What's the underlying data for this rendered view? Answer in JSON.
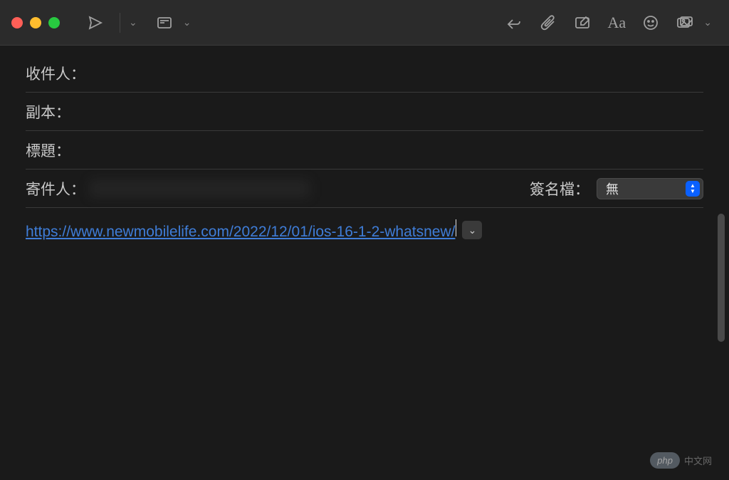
{
  "fields": {
    "to_label": "收件人：",
    "cc_label": "副本：",
    "subject_label": "標題：",
    "from_label": "寄件人：",
    "signature_label": "簽名檔：",
    "signature_value": "無"
  },
  "compose": {
    "link_text": "https://www.newmobilelife.com/2022/12/01/ios-16-1-2-whatsnew/",
    "link_href": "https://www.newmobilelife.com/2022/12/01/ios-16-1-2-whatsnew/"
  },
  "watermark": {
    "badge": "php",
    "text": "中文网"
  }
}
